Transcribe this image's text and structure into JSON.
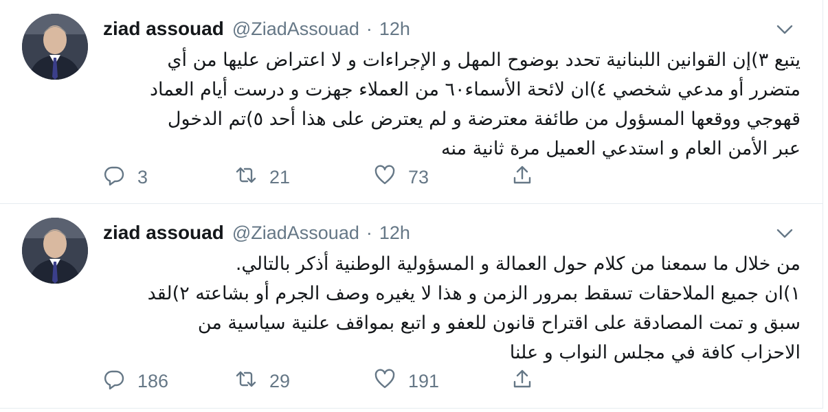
{
  "tweets": [
    {
      "author_name": "ziad assouad",
      "handle": "@ZiadAssouad",
      "separator": "·",
      "time": "12h",
      "lines": [
        "يتبع ٣)إن القوانين اللبنانية تحدد بوضوح المهل و الإجراءات  و لا اعتراض عليها من أي",
        "متضرر أو مدعي شخصي ٤)ان لائحة  الأسماء٦٠ من العملاء جهزت و درست أيام العماد",
        "قهوجي ووقعها المسؤول من طائفة معترضة و لم يعترض على هذا أحد ٥)تم الدخول",
        "عبر الأمن العام و استدعي العميل  مرة ثانية منه"
      ],
      "replies": "3",
      "retweets": "21",
      "likes": "73"
    },
    {
      "author_name": "ziad assouad",
      "handle": "@ZiadAssouad",
      "separator": "·",
      "time": "12h",
      "lines": [
        "من خلال ما سمعنا من كلام حول العمالة و المسؤولية  الوطنية أذكر بالتالي.",
        "١)ان جميع الملاحقات تسقط بمرور الزمن و هذا لا يغيره وصف الجرم أو بشاعته ٢)لقد",
        "سبق و تمت المصادقة على اقتراح قانون للعفو و اتبع بمواقف علنية سياسية من",
        "الاحزاب كافة في مجلس النواب و علنا"
      ],
      "replies": "186",
      "retweets": "29",
      "likes": "191"
    }
  ],
  "icons": {
    "reply": "reply-icon",
    "retweet": "retweet-icon",
    "like": "heart-icon",
    "share": "share-icon",
    "caret": "chevron-down-icon"
  },
  "colors": {
    "text": "#14171a",
    "secondary": "#657786",
    "divider": "#e6ecf0"
  }
}
